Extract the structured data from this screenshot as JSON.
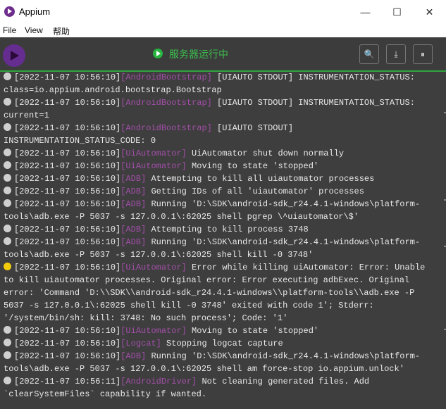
{
  "window": {
    "title": "Appium",
    "minimize_glyph": "—",
    "maximize_glyph": "☐",
    "close_glyph": "✕"
  },
  "menu": {
    "file": "File",
    "view": "View",
    "help": "帮助"
  },
  "toolbar": {
    "status": "服务器运行中",
    "buttons": [
      {
        "icon": "search-icon",
        "glyph": "🔍"
      },
      {
        "icon": "download-icon",
        "glyph": "⤓"
      },
      {
        "icon": "pause-icon",
        "glyph": "⏸"
      }
    ]
  },
  "log": {
    "lines": [
      {
        "ts": "[2022-11-07 10:56:10]",
        "tag": "[AndroidBootstrap]",
        "msg": " [UIAUTO STDOUT] INSTRUMENTATION_STATUS:"
      },
      {
        "cont": "class=io.appium.android.bootstrap.Bootstrap"
      },
      {
        "ts": "[2022-11-07 10:56:10]",
        "tag": "[AndroidBootstrap]",
        "msg": " [UIAUTO STDOUT] INSTRUMENTATION_STATUS:"
      },
      {
        "cont": "current=1"
      },
      {
        "ts": "[2022-11-07 10:56:10]",
        "tag": "[AndroidBootstrap]",
        "msg": " [UIAUTO STDOUT]"
      },
      {
        "cont": "INSTRUMENTATION_STATUS_CODE: 0"
      },
      {
        "ts": "[2022-11-07 10:56:10]",
        "tag": "[UiAutomator]",
        "msg": " UiAutomator shut down normally"
      },
      {
        "ts": "[2022-11-07 10:56:10]",
        "tag": "[UiAutomator]",
        "msg": " Moving to state 'stopped'"
      },
      {
        "ts": "[2022-11-07 10:56:10]",
        "tag": "[ADB]",
        "msg": " Attempting to kill all uiautomator processes"
      },
      {
        "ts": "[2022-11-07 10:56:10]",
        "tag": "[ADB]",
        "msg": " Getting IDs of all 'uiautomator' processes"
      },
      {
        "ts": "[2022-11-07 10:56:10]",
        "tag": "[ADB]",
        "msg": " Running 'D:\\SDK\\android-sdk_r24.4.1-windows\\platform-"
      },
      {
        "cont": "tools\\adb.exe -P 5037 -s 127.0.0.1\\:62025 shell pgrep \\^uiautomator\\$'"
      },
      {
        "ts": "[2022-11-07 10:56:10]",
        "tag": "[ADB]",
        "msg": " Attempting to kill process 3748"
      },
      {
        "ts": "[2022-11-07 10:56:10]",
        "tag": "[ADB]",
        "msg": " Running 'D:\\SDK\\android-sdk_r24.4.1-windows\\platform-"
      },
      {
        "cont": "tools\\adb.exe -P 5037 -s 127.0.0.1\\:62025 shell kill -0 3748'"
      },
      {
        "ts": "[2022-11-07 10:56:10]",
        "tag": "[UiAutomator]",
        "msg": " Error while killing uiAutomator: Error: Unable",
        "warn": true
      },
      {
        "cont": "to kill uiautomator processes. Original error: Error executing adbExec. Original"
      },
      {
        "cont": "error: 'Command 'D:\\\\SDK\\\\android-sdk_r24.4.1-windows\\\\platform-tools\\\\adb.exe -P"
      },
      {
        "cont": "5037 -s 127.0.0.1\\:62025 shell kill -0 3748' exited with code 1'; Stderr:"
      },
      {
        "cont": "'/system/bin/sh: kill: 3748: No such process'; Code: '1'"
      },
      {
        "ts": "[2022-11-07 10:56:10]",
        "tag": "[UiAutomator]",
        "msg": " Moving to state 'stopped'"
      },
      {
        "ts": "[2022-11-07 10:56:10]",
        "tag": "[Logcat]",
        "msg": " Stopping logcat capture"
      },
      {
        "ts": "[2022-11-07 10:56:10]",
        "tag": "[ADB]",
        "msg": " Running 'D:\\SDK\\android-sdk_r24.4.1-windows\\platform-"
      },
      {
        "cont": "tools\\adb.exe -P 5037 -s 127.0.0.1\\:62025 shell am force-stop io.appium.unlock'"
      },
      {
        "ts": "[2022-11-07 10:56:11]",
        "tag": "[AndroidDriver]",
        "msg": " Not cleaning generated files. Add"
      },
      {
        "cont": "`clearSystemFiles` capability if wanted."
      }
    ]
  },
  "colors": {
    "tag": "#a24fa8",
    "status": "#3cc04e",
    "console_bg": "#3e3e3e",
    "toolbar_bg": "#3c3c3c",
    "warn": "#f2cc0c"
  }
}
